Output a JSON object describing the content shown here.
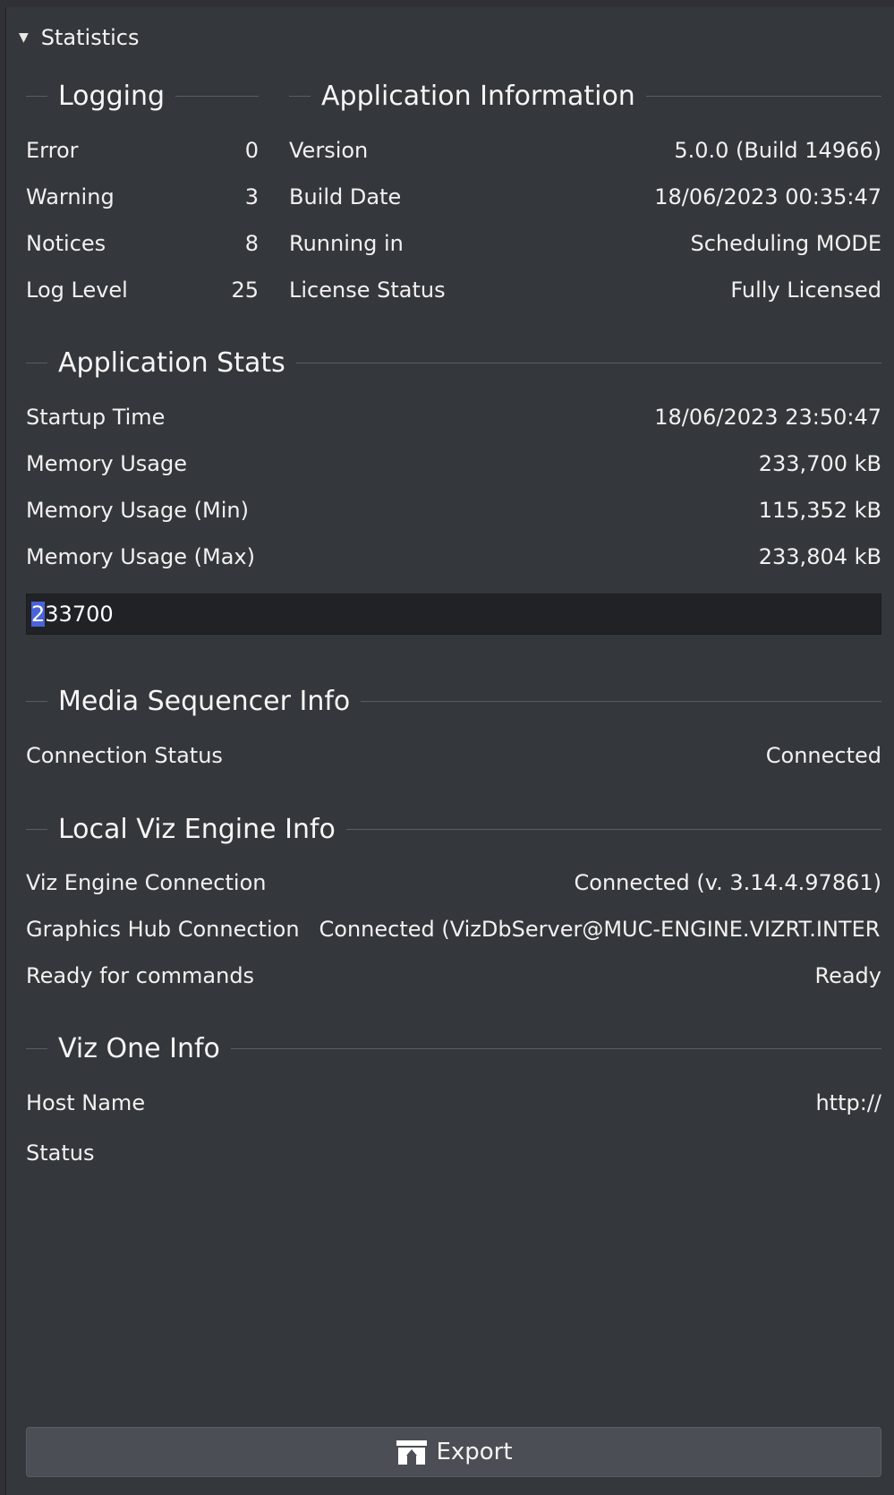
{
  "header": {
    "title": "Statistics"
  },
  "logging": {
    "title": "Logging",
    "rows": [
      {
        "label": "Error",
        "value": "0"
      },
      {
        "label": "Warning",
        "value": "3"
      },
      {
        "label": "Notices",
        "value": "8"
      },
      {
        "label": "Log Level",
        "value": "25"
      }
    ]
  },
  "app_info": {
    "title": "Application Information",
    "rows": [
      {
        "label": "Version",
        "value": "5.0.0 (Build 14966)"
      },
      {
        "label": "Build Date",
        "value": "18/06/2023 00:35:47"
      },
      {
        "label": "Running in",
        "value": "Scheduling MODE"
      },
      {
        "label": "License Status",
        "value": "Fully Licensed"
      }
    ]
  },
  "app_stats": {
    "title": "Application Stats",
    "rows": [
      {
        "label": "Startup Time",
        "value": "18/06/2023 23:50:47"
      },
      {
        "label": "Memory Usage",
        "value": "233,700 kB"
      },
      {
        "label": "Memory Usage (Min)",
        "value": "115,352 kB"
      },
      {
        "label": "Memory Usage (Max)",
        "value": "233,804 kB"
      }
    ],
    "memory_field": {
      "selected": "2",
      "rest": "33700"
    }
  },
  "media_sequencer": {
    "title": "Media Sequencer Info",
    "rows": [
      {
        "label": "Connection Status",
        "value": "Connected"
      }
    ]
  },
  "viz_engine": {
    "title": "Local Viz Engine Info",
    "rows": [
      {
        "label": "Viz Engine Connection",
        "value": "Connected (v. 3.14.4.97861)"
      },
      {
        "label": "Graphics Hub Connection",
        "value": "Connected (VizDbServer@MUC-ENGINE.VIZRT.INTER"
      },
      {
        "label": "Ready for commands",
        "value": "Ready"
      }
    ]
  },
  "viz_one": {
    "title": "Viz One Info",
    "rows": [
      {
        "label": "Host Name",
        "value": "http://"
      },
      {
        "label": "Status",
        "value": ""
      }
    ]
  },
  "export": {
    "label": "Export"
  }
}
